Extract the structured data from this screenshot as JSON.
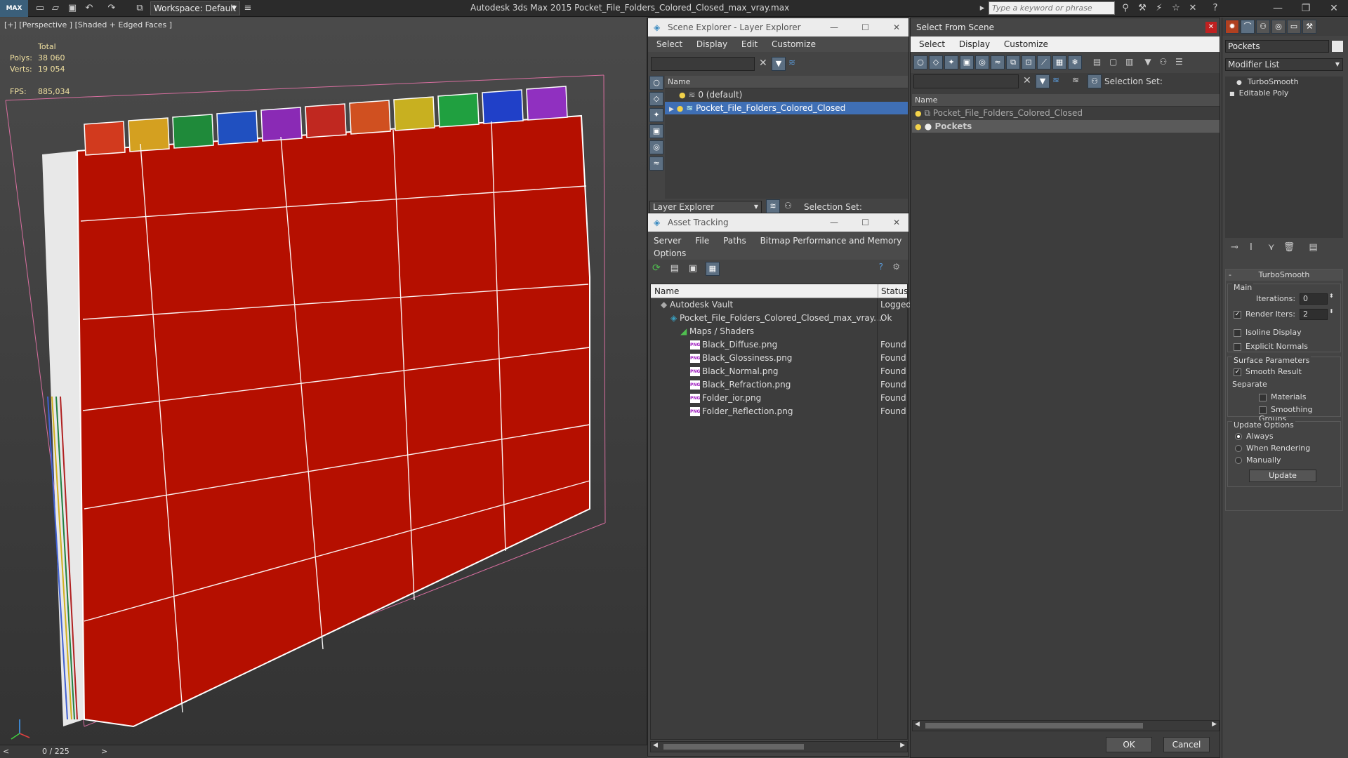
{
  "titlebar": {
    "logo": "MAX",
    "workspace_label": "Workspace: Default",
    "app_title": "Autodesk 3ds Max  2015     Pocket_File_Folders_Colored_Closed_max_vray.max",
    "search_placeholder": "Type a keyword or phrase"
  },
  "viewport": {
    "label": "[+] [Perspective ] [Shaded + Edged Faces ]",
    "stats": {
      "total_label": "Total",
      "polys_label": "Polys:",
      "polys_value": "38 060",
      "verts_label": "Verts:",
      "verts_value": "19 054",
      "fps_label": "FPS:",
      "fps_value": "885,034"
    },
    "folder_color": "#b50f00",
    "tab_colors": [
      "#d23a1e",
      "#d4a020",
      "#1f8a3a",
      "#2050c0",
      "#8a2ab5",
      "#c02820",
      "#d05020",
      "#c8b020",
      "#20a040",
      "#2040c8",
      "#9030c0"
    ]
  },
  "timeline": {
    "frame_label": "0 / 225"
  },
  "scene_explorer": {
    "title": "Scene Explorer - Layer Explorer",
    "menus": [
      "Select",
      "Display",
      "Edit",
      "Customize"
    ],
    "column_name": "Name",
    "rows": [
      "0 (default)",
      "Pocket_File_Folders_Colored_Closed"
    ],
    "explorer_select": "Layer Explorer",
    "selection_set_label": "Selection Set:"
  },
  "asset_tracking": {
    "title": "Asset Tracking",
    "menus": [
      "Server",
      "File",
      "Paths",
      "Bitmap Performance and Memory",
      "Options"
    ],
    "col_name": "Name",
    "col_status": "Status",
    "rows": [
      {
        "name": "Autodesk Vault",
        "status": "Logged",
        "indent": 0
      },
      {
        "name": "Pocket_File_Folders_Colored_Closed_max_vray....",
        "status": "Ok",
        "indent": 1
      },
      {
        "name": "Maps / Shaders",
        "status": "",
        "indent": 2
      },
      {
        "name": "Black_Diffuse.png",
        "status": "Found",
        "indent": 3
      },
      {
        "name": "Black_Glossiness.png",
        "status": "Found",
        "indent": 3
      },
      {
        "name": "Black_Normal.png",
        "status": "Found",
        "indent": 3
      },
      {
        "name": "Black_Refraction.png",
        "status": "Found",
        "indent": 3
      },
      {
        "name": "Folder_ior.png",
        "status": "Found",
        "indent": 3
      },
      {
        "name": "Folder_Reflection.png",
        "status": "Found",
        "indent": 3
      }
    ]
  },
  "select_from_scene": {
    "title": "Select From Scene",
    "menus": [
      "Select",
      "Display",
      "Customize"
    ],
    "selection_set_label": "Selection Set:",
    "column_name": "Name",
    "rows": [
      "Pocket_File_Folders_Colored_Closed",
      "Pockets"
    ],
    "ok": "OK",
    "cancel": "Cancel"
  },
  "command_panel": {
    "object_name": "Pockets",
    "modifier_list": "Modifier List",
    "stack": [
      "TurboSmooth",
      "Editable Poly"
    ],
    "rollout_title": "TurboSmooth",
    "main_label": "Main",
    "iterations_label": "Iterations:",
    "iterations_value": "0",
    "render_iters_label": "Render Iters:",
    "render_iters_value": "2",
    "isoline": "Isoline Display",
    "explicit_normals": "Explicit Normals",
    "surface_params": "Surface Parameters",
    "smooth_result": "Smooth Result",
    "separate": "Separate",
    "materials": "Materials",
    "smoothing_groups": "Smoothing Groups",
    "update_options": "Update Options",
    "always": "Always",
    "when_rendering": "When Rendering",
    "manually": "Manually",
    "update_button": "Update"
  }
}
